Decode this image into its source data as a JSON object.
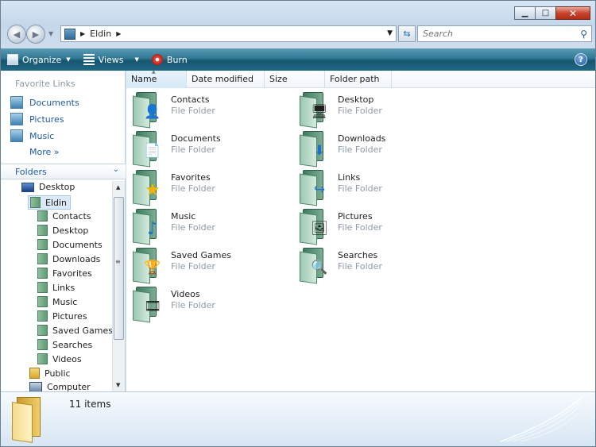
{
  "window": {
    "minimize_glyph": "▁",
    "maximize_glyph": "□",
    "close_glyph": "✕"
  },
  "address": {
    "path": "Eldin",
    "separator": "▶"
  },
  "search": {
    "placeholder": "Search"
  },
  "toolbar": {
    "organize_label": "Organize",
    "views_label": "Views",
    "burn_label": "Burn",
    "help_label": "?"
  },
  "favorites": {
    "title": "Favorite Links",
    "items": [
      {
        "label": "Documents"
      },
      {
        "label": "Pictures"
      },
      {
        "label": "Music"
      }
    ],
    "more_label": "More  »"
  },
  "folders_pane": {
    "title": "Folders",
    "chevron": "⌄"
  },
  "tree": [
    {
      "label": "Desktop",
      "icon": "desktop-icon"
    },
    {
      "label": "Eldin",
      "icon": "user-folder-icon",
      "selected": true
    },
    {
      "label": "Contacts",
      "icon": "contacts-folder-icon"
    },
    {
      "label": "Desktop",
      "icon": "desktop-folder-icon"
    },
    {
      "label": "Documents",
      "icon": "documents-folder-icon"
    },
    {
      "label": "Downloads",
      "icon": "downloads-folder-icon"
    },
    {
      "label": "Favorites",
      "icon": "favorites-folder-icon"
    },
    {
      "label": "Links",
      "icon": "links-folder-icon"
    },
    {
      "label": "Music",
      "icon": "music-folder-icon"
    },
    {
      "label": "Pictures",
      "icon": "pictures-folder-icon"
    },
    {
      "label": "Saved Games",
      "icon": "saved-games-folder-icon"
    },
    {
      "label": "Searches",
      "icon": "searches-folder-icon"
    },
    {
      "label": "Videos",
      "icon": "videos-folder-icon"
    },
    {
      "label": "Public",
      "icon": "public-folder-icon"
    },
    {
      "label": "Computer",
      "icon": "computer-icon"
    }
  ],
  "columns": {
    "name": "Name",
    "date_modified": "Date modified",
    "size": "Size",
    "folder_path": "Folder path"
  },
  "files": [
    {
      "name": "Contacts",
      "type": "File Folder",
      "glyph": "👤",
      "icon": "contacts-folder-icon"
    },
    {
      "name": "Desktop",
      "type": "File Folder",
      "glyph": "🖥",
      "icon": "desktop-folder-icon"
    },
    {
      "name": "Documents",
      "type": "File Folder",
      "glyph": "📄",
      "icon": "documents-folder-icon"
    },
    {
      "name": "Downloads",
      "type": "File Folder",
      "glyph": "⬇",
      "icon": "downloads-folder-icon"
    },
    {
      "name": "Favorites",
      "type": "File Folder",
      "glyph": "★",
      "icon": "favorites-folder-icon"
    },
    {
      "name": "Links",
      "type": "File Folder",
      "glyph": "↪",
      "icon": "links-folder-icon"
    },
    {
      "name": "Music",
      "type": "File Folder",
      "glyph": "♪",
      "icon": "music-folder-icon"
    },
    {
      "name": "Pictures",
      "type": "File Folder",
      "glyph": "🖼",
      "icon": "pictures-folder-icon"
    },
    {
      "name": "Saved Games",
      "type": "File Folder",
      "glyph": "🏆",
      "icon": "saved-games-folder-icon"
    },
    {
      "name": "Searches",
      "type": "File Folder",
      "glyph": "🔍",
      "icon": "searches-folder-icon"
    },
    {
      "name": "Videos",
      "type": "File Folder",
      "glyph": "🎞",
      "icon": "videos-folder-icon"
    }
  ],
  "details": {
    "count_text": "11 items"
  },
  "colors": {
    "toolbar": "#1f6884",
    "link_blue": "#1f5aa8",
    "folder_teal": "#5c9a74",
    "subtext_gray": "#8e9aa6"
  }
}
